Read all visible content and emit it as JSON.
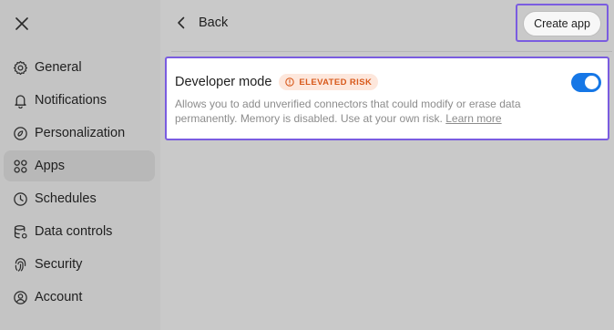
{
  "sidebar": {
    "items": [
      {
        "label": "General",
        "icon": "gear-icon"
      },
      {
        "label": "Notifications",
        "icon": "bell-icon"
      },
      {
        "label": "Personalization",
        "icon": "personalization-icon"
      },
      {
        "label": "Apps",
        "icon": "apps-grid-icon",
        "active": true
      },
      {
        "label": "Schedules",
        "icon": "clock-icon"
      },
      {
        "label": "Data controls",
        "icon": "database-icon"
      },
      {
        "label": "Security",
        "icon": "fingerprint-icon"
      },
      {
        "label": "Account",
        "icon": "user-icon"
      }
    ]
  },
  "header": {
    "back_label": "Back",
    "create_label": "Create app"
  },
  "developer_mode": {
    "title": "Developer mode",
    "badge": "ELEVATED RISK",
    "description": "Allows you to add unverified connectors that could modify or erase data permanently. Memory is disabled. Use at your own risk.",
    "link": "Learn more",
    "enabled": true
  },
  "colors": {
    "accent": "#1677e6",
    "highlight": "#7a5ce0",
    "risk": "#d85a1c",
    "risk_bg": "#fde7dc"
  }
}
